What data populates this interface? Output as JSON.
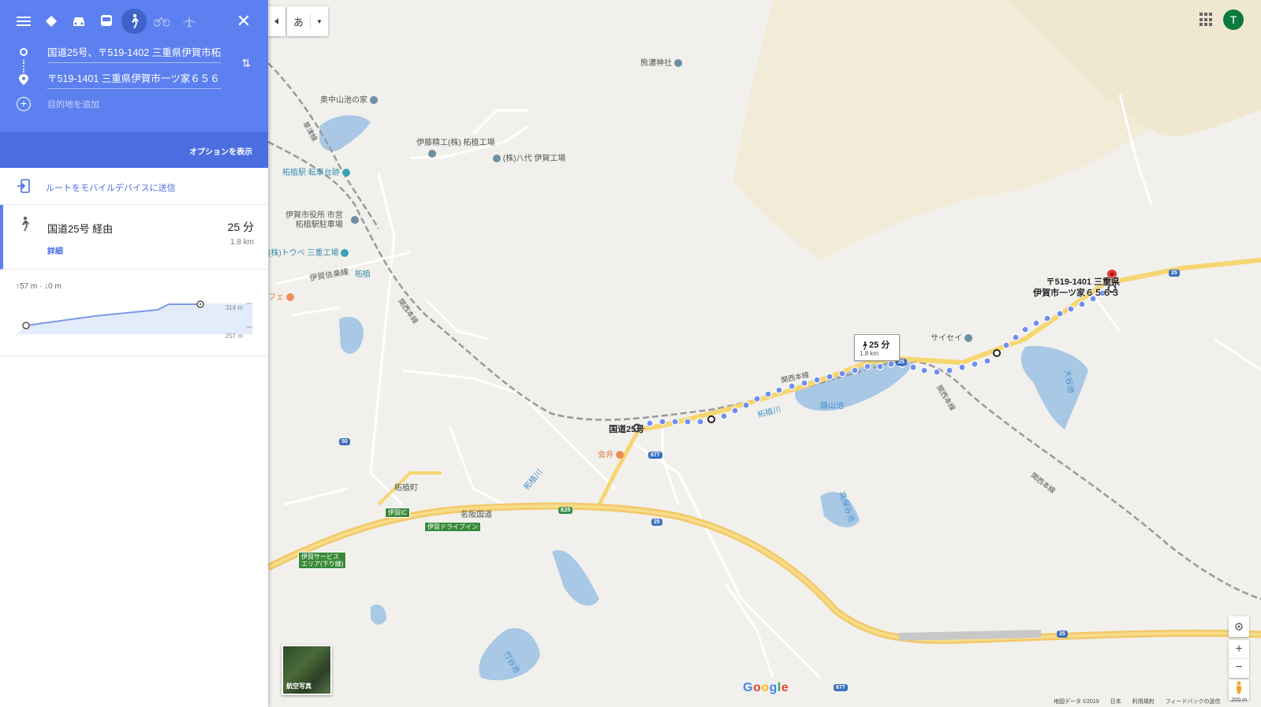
{
  "modes": [
    {
      "name": "menu-icon",
      "glyph": "☰"
    },
    {
      "name": "directions-icon",
      "glyph": "◆"
    },
    {
      "name": "car-icon",
      "glyph": "🚗"
    },
    {
      "name": "transit-icon",
      "glyph": "🚆"
    },
    {
      "name": "walk-icon",
      "glyph": "🚶"
    },
    {
      "name": "bike-icon",
      "glyph": "🚲"
    },
    {
      "name": "flight-icon",
      "glyph": "✈"
    }
  ],
  "close_glyph": "✕",
  "origin": "国道25号、〒519-1402 三重県伊賀市柘",
  "destination": "〒519-1401 三重県伊賀市一ツ家６５６",
  "add_destination": "目的地を追加",
  "options_label": "オプションを表示",
  "send_to_mobile": "ルートをモバイルデバイスに送信",
  "route": {
    "via": "国道25号 経由",
    "duration": "25 分",
    "distance": "1.8 km",
    "details": "詳細"
  },
  "elevation": {
    "stats": "↑57 m · ↓0 m",
    "high": "314 m",
    "low": "257 m"
  },
  "map": {
    "ime_char": "あ",
    "avatar_letter": "T",
    "duration_box": {
      "time": "25 分",
      "dist": "1.8 km"
    },
    "destination_label_line1": "〒519-1401 三重県",
    "destination_label_line2": "伊賀市一ツ家６５６３",
    "origin_label": "国道25号",
    "aerial_label": "航空写真",
    "google_logo": "Google",
    "labels": {
      "kumano": "熊濃神社",
      "okunaka": "奥中山池の家",
      "ito": "伊藤精工(株) 柘植工場",
      "yashiro": "(株)八代 伊賀工場",
      "tsuge_station_ruins": "柘植駅 転車台跡",
      "city_parking_1": "伊賀市役所 市営",
      "city_parking_2": "柘植駅駐車場",
      "tobe": "(株)トウベ 三重工場",
      "iga_line": "伊賀信楽線",
      "tsuge": "柘植",
      "cafe": "フェ",
      "kansai_main_1": "関西本線",
      "kansai_main_2": "関西本線",
      "kansai_main_3": "関西本線",
      "kansai_main_4": "関西本線",
      "kusayama": "草津線",
      "saisei": "サイセイ",
      "aiben": "会弁",
      "tsugecho": "柘植町",
      "meihan": "名阪国道",
      "tsuge_river_1": "柘植川",
      "tsuge_river_2": "柘植川",
      "suke_pond": "踊山池",
      "ogi_pond": "大谷池",
      "nashi_pond": "高保谷池",
      "takeya_pond": "竹谷池"
    },
    "shields": {
      "r25_a": "25",
      "r25_b": "25",
      "r25_c": "25",
      "r25_d": "25",
      "r25_e": "25",
      "e25": "E25",
      "r50": "50",
      "r677_a": "677",
      "r677_b": "677"
    },
    "green": {
      "iga_ic": "伊賀IC",
      "iga_drive_in": "伊賀ドライブイン",
      "iga_sa_1": "伊賀サービス",
      "iga_sa_2": "エリア(下り線)"
    },
    "footer": [
      "地図データ ©2019",
      "日本",
      "利用規約",
      "フィードバックの送信",
      "200 m"
    ]
  }
}
